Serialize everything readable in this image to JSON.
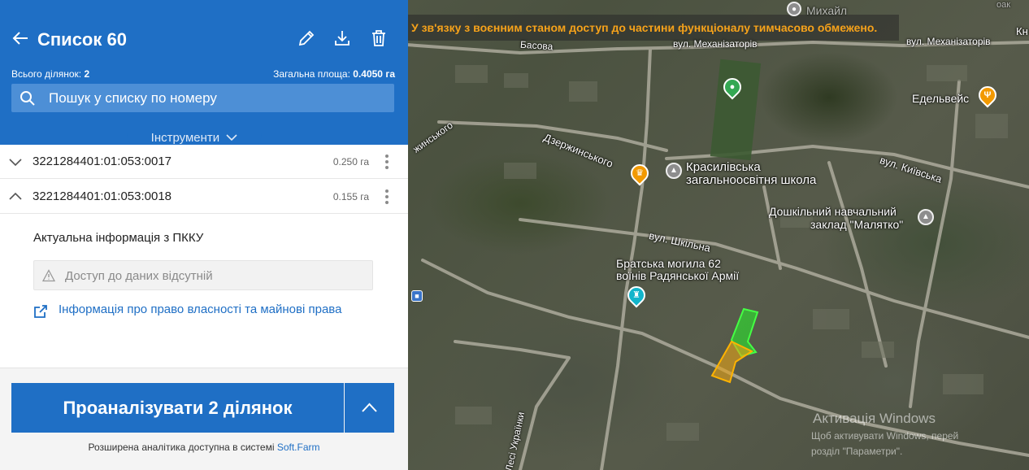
{
  "panel": {
    "title": "Список 60",
    "stats": {
      "parcels_label": "Всього ділянок:",
      "parcels_value": "2",
      "area_label": "Загальна площа:",
      "area_value": "0.4050 га"
    },
    "search": {
      "placeholder": "Пошук у списку по номеру"
    },
    "tools_label": "Інструменти",
    "parcels": [
      {
        "number": "3221284401:01:053:0017",
        "area": "0.250 га",
        "expanded": false
      },
      {
        "number": "3221284401:01:053:0018",
        "area": "0.155 га",
        "expanded": true
      }
    ],
    "details": {
      "pkku_title": "Актуальна інформація з ПККУ",
      "no_access": "Доступ до даних відсутній",
      "rights_link": "Інформація про право власності та майнові права"
    },
    "footer": {
      "analyze_label": "Проаналізувати 2 ділянок",
      "note_prefix": "Розширена аналітика доступна в системі ",
      "note_link": "Soft.Farm"
    }
  },
  "map": {
    "banner": "У зв'язку з воєнним станом доступ до частини функціоналу тимчасово обмежено.",
    "labels": {
      "mykhailo": "Михайл",
      "basova": "Басова",
      "mekhanizatoriv_1": "вул. Механізаторів",
      "mekhanizatoriv_2": "вул. Механізаторів",
      "kn": "Кн",
      "edelweis": "Едельвейс",
      "dzerzhynskoho": "Дзержинського",
      "dzerzhynskoho_left": "жинського",
      "school_1": "Красилівська",
      "school_2": "загальноосвітня школа",
      "kyivska": "вул. Київська",
      "kindergarten_1": "Дошкільний навчальний",
      "kindergarten_2": "заклад \"Малятко\"",
      "shkilna": "вул. Шкільна",
      "grave_1": "Братська могила 62",
      "grave_2": "воїнів Радянської Армії",
      "ukrainky": "Лесі Українки",
      "oak": "оак"
    },
    "activation": {
      "title": "Активація Windows",
      "line1": "Щоб активувати Windows, перей",
      "line2": "розділ \"Параметри\"."
    },
    "colors": {
      "parcel_green": "#33cc33",
      "parcel_orange": "#e8a317",
      "accent": "#1f6fc5",
      "banner_text": "#f6a21a"
    }
  }
}
